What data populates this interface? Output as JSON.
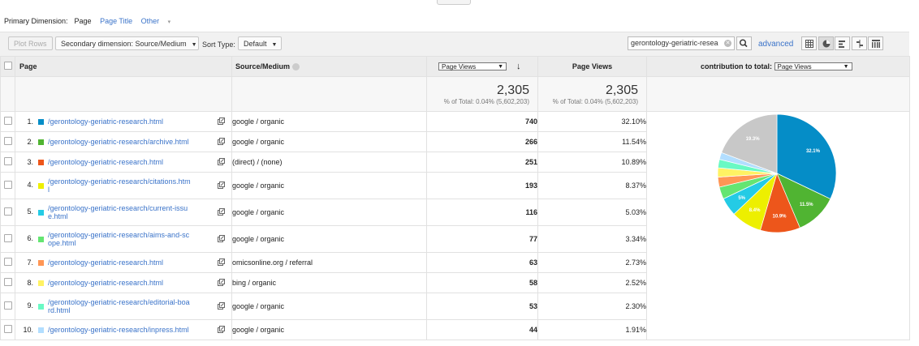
{
  "dims": {
    "label": "Primary Dimension:",
    "active": "Page",
    "page_title": "Page Title",
    "other": "Other",
    "caret": "▾"
  },
  "toolbar": {
    "plot_rows": "Plot Rows",
    "secondary": "Secondary dimension: Source/Medium",
    "sort_label": "Sort Type:",
    "sort_value": "Default",
    "search_value": "gerontology-geriatric-resea",
    "advanced": "advanced"
  },
  "headers": {
    "page": "Page",
    "source": "Source/Medium",
    "metric1_select": "Page Views",
    "metric2": "Page Views",
    "contribution": "contribution to total:",
    "contribution_select": "Page Views"
  },
  "summary": {
    "m1_total": "2,305",
    "m1_pct": "% of Total: 0.04% (5,602,203)",
    "m2_total": "2,305",
    "m2_pct": "% of Total: 0.04% (5,602,203)"
  },
  "colors": [
    "#058dc7",
    "#50b432",
    "#ed561b",
    "#edef00",
    "#24cbe5",
    "#64e572",
    "#ff9655",
    "#fff263",
    "#6af9c4",
    "#b2deff"
  ],
  "rows": [
    {
      "n": "1.",
      "page": "/gerontology-geriatric-research.html",
      "source": "google / organic",
      "views": "740",
      "pct": "32.10%"
    },
    {
      "n": "2.",
      "page": "/gerontology-geriatric-research/archive.html",
      "source": "google / organic",
      "views": "266",
      "pct": "11.54%"
    },
    {
      "n": "3.",
      "page": "/gerontology-geriatric-research.html",
      "source": "(direct) / (none)",
      "views": "251",
      "pct": "10.89%"
    },
    {
      "n": "4.",
      "page": "/gerontology-geriatric-research/citations.htm",
      "page2": "l",
      "source": "google / organic",
      "views": "193",
      "pct": "8.37%"
    },
    {
      "n": "5.",
      "page": "/gerontology-geriatric-research/current-issu",
      "page2": "e.html",
      "source": "google / organic",
      "views": "116",
      "pct": "5.03%"
    },
    {
      "n": "6.",
      "page": "/gerontology-geriatric-research/aims-and-sc",
      "page2": "ope.html",
      "source": "google / organic",
      "views": "77",
      "pct": "3.34%"
    },
    {
      "n": "7.",
      "page": "/gerontology-geriatric-research.html",
      "source": "omicsonline.org / referral",
      "views": "63",
      "pct": "2.73%"
    },
    {
      "n": "8.",
      "page": "/gerontology-geriatric-research.html",
      "source": "bing / organic",
      "views": "58",
      "pct": "2.52%"
    },
    {
      "n": "9.",
      "page": "/gerontology-geriatric-research/editorial-boa",
      "page2": "rd.html",
      "source": "google / organic",
      "views": "53",
      "pct": "2.30%"
    },
    {
      "n": "10.",
      "page": "/gerontology-geriatric-research/inpress.html",
      "source": "google / organic",
      "views": "44",
      "pct": "1.91%"
    }
  ],
  "chart_data": {
    "type": "pie",
    "categories": [
      "1.",
      "2.",
      "3.",
      "4.",
      "5.",
      "6.",
      "7.",
      "8.",
      "9.",
      "10.",
      "other"
    ],
    "values": [
      32.1,
      11.54,
      10.89,
      8.37,
      5.03,
      3.34,
      2.73,
      2.52,
      2.3,
      1.91,
      19.27
    ],
    "labels": [
      "32.1%",
      "11.5%",
      "10.9%",
      "8.4%",
      "5%",
      "",
      "",
      "",
      "",
      "",
      "19.3%"
    ],
    "colors": [
      "#058dc7",
      "#50b432",
      "#ed561b",
      "#edef00",
      "#24cbe5",
      "#64e572",
      "#ff9655",
      "#fff263",
      "#6af9c4",
      "#b2deff",
      "#c8c8c8"
    ]
  }
}
